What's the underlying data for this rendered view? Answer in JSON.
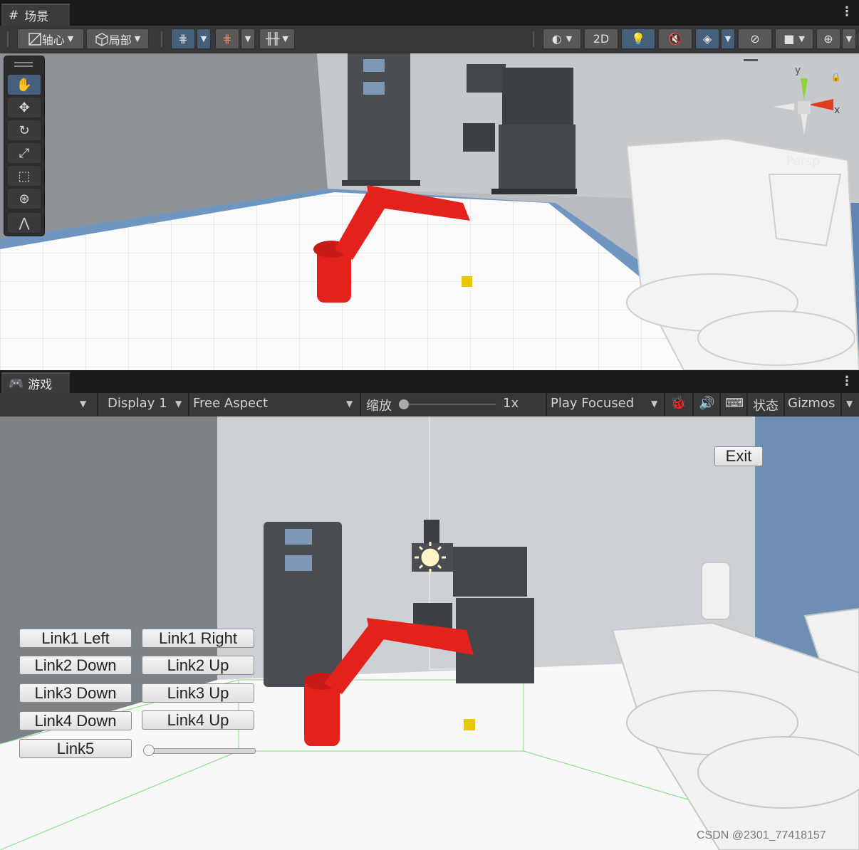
{
  "scene_tab": {
    "icon": "grid-icon",
    "label": "场景"
  },
  "scene_toolbar": {
    "pivot_label": "轴心",
    "local_label": "局部",
    "mode_2d": "2D"
  },
  "scene_view": {
    "axis_y": "y",
    "axis_x": "x",
    "projection": "Persp"
  },
  "tools": [
    "hand-icon",
    "move-icon",
    "rotate-icon",
    "scale-icon",
    "rect-icon",
    "transform-icon",
    "custom-tool-icon"
  ],
  "game_tab": {
    "icon": "gamepad-icon",
    "label": "游戏"
  },
  "game_toolbar": {
    "display": "Display 1",
    "aspect": "Free Aspect",
    "scale_label": "缩放",
    "scale_value": "1x",
    "play_mode": "Play Focused",
    "stats": "状态",
    "gizmos": "Gizmos"
  },
  "game_ui": {
    "exit": "Exit",
    "buttons": [
      {
        "left": "Link1 Left",
        "right": "Link1 Right"
      },
      {
        "left": "Link2 Down",
        "right": "Link2 Up"
      },
      {
        "left": "Link3 Down",
        "right": "Link3 Up"
      },
      {
        "left": "Link4 Down",
        "right": "Link4 Up"
      }
    ],
    "link5": "Link5",
    "link5_slider": 0.0
  },
  "watermark": "CSDN @2301_77418157",
  "colors": {
    "accent_blue": "#46607c",
    "robot_red": "#e02020",
    "cube_yellow": "#f0d000"
  }
}
